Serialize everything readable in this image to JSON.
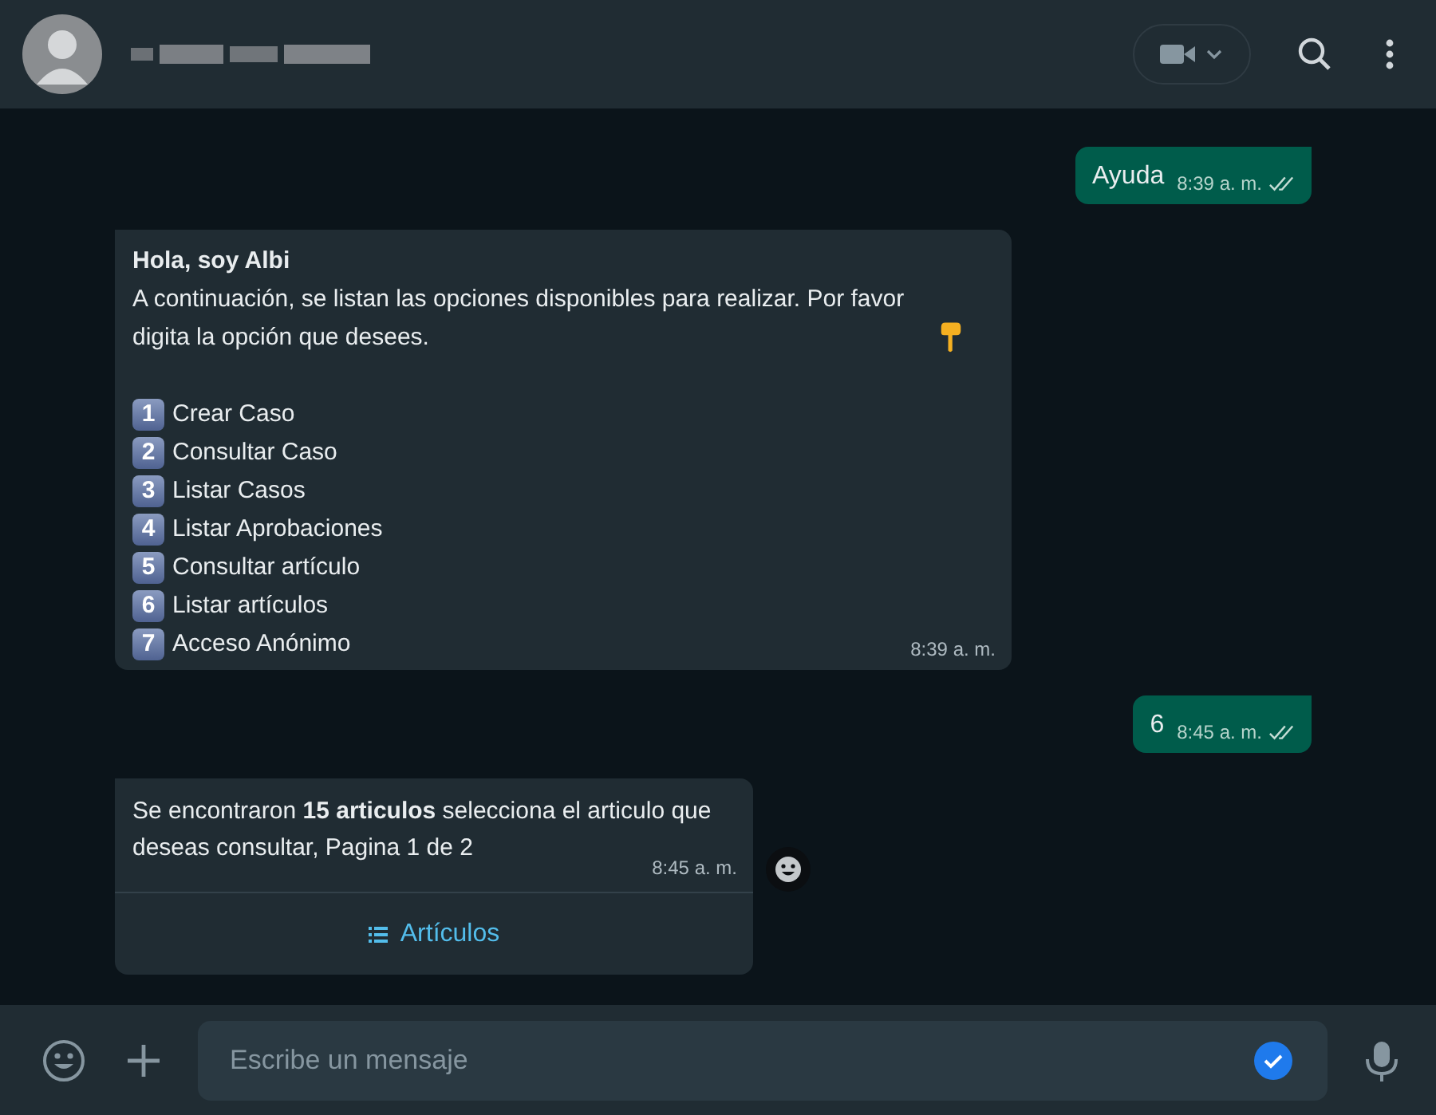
{
  "messages": [
    {
      "kind": "sent",
      "text": "Ayuda",
      "time": "8:39 a. m.",
      "read": true
    },
    {
      "kind": "received",
      "title": "Hola, soy Albi",
      "text": "A continuación, se listan las opciones disponibles para realizar. Por favor digita la opción que desees.",
      "options": [
        {
          "number": "1",
          "label": "Crear Caso"
        },
        {
          "number": "2",
          "label": "Consultar Caso"
        },
        {
          "number": "3",
          "label": "Listar Casos"
        },
        {
          "number": "4",
          "label": "Listar Aprobaciones"
        },
        {
          "number": "5",
          "label": "Consultar artículo"
        },
        {
          "number": "6",
          "label": "Listar artículos"
        },
        {
          "number": "7",
          "label": "Acceso Anónimo"
        }
      ],
      "time": "8:39 a. m."
    },
    {
      "kind": "sent",
      "text": "6",
      "time": "8:45 a. m.",
      "read": true
    },
    {
      "kind": "list",
      "text": "Se encontraron **15 articulos** selecciona el articulo que deseas consultar, Pagina 1 de 2",
      "time": "8:45 a. m.",
      "button": "Artículos"
    }
  ],
  "composer": {
    "placeholder": "Escribe un mensaje"
  }
}
